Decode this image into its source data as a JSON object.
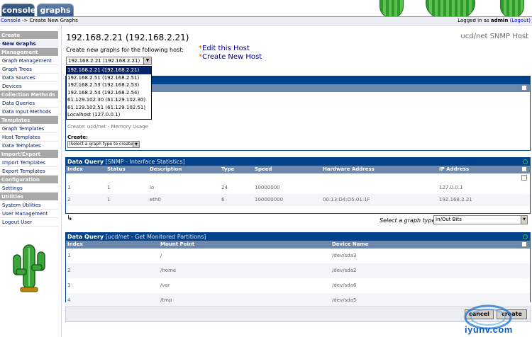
{
  "tabs": [
    {
      "label": "console",
      "active": true
    },
    {
      "label": "graphs",
      "active": false
    }
  ],
  "breadcrumb": {
    "root": "Console",
    "separator": " -> ",
    "current": "Create New Graphs"
  },
  "login": {
    "prefix": "Logged in as ",
    "user": "admin",
    "logout": "(Logout)"
  },
  "sidebar": {
    "sections": [
      {
        "header": "Create",
        "items": [
          {
            "label": "New Graphs",
            "active": true
          }
        ]
      },
      {
        "header": "Management",
        "items": [
          {
            "label": "Graph Management"
          },
          {
            "label": "Graph Trees"
          },
          {
            "label": "Data Sources"
          },
          {
            "label": "Devices"
          }
        ]
      },
      {
        "header": "Collection Methods",
        "items": [
          {
            "label": "Data Queries"
          },
          {
            "label": "Data Input Methods"
          }
        ]
      },
      {
        "header": "Templates",
        "items": [
          {
            "label": "Graph Templates"
          },
          {
            "label": "Host Templates"
          },
          {
            "label": "Data Templates"
          }
        ]
      },
      {
        "header": "Import/Export",
        "items": [
          {
            "label": "Import Templates"
          },
          {
            "label": "Export Templates"
          }
        ]
      },
      {
        "header": "Configuration",
        "items": [
          {
            "label": "Settings"
          }
        ]
      },
      {
        "header": "Utilities",
        "items": [
          {
            "label": "System Utilities"
          },
          {
            "label": "User Management"
          },
          {
            "label": "Logout User"
          }
        ]
      }
    ]
  },
  "host": {
    "title": "192.168.2.21 (192.168.2.21)",
    "template": "ucd/net SNMP Host",
    "prompt": "Create new graphs for the following host:",
    "selected": "192.168.2.21 (192.168.2.21)",
    "options": [
      "192.168.2.21 (192.168.2.21)",
      "192.168.2.51 (192.168.2.51)",
      "192.168.2.53 (192.168.2.53)",
      "192.168.2.54 (192.168.2.54)",
      "61.129.102.30 (61.129.102.30)",
      "61.129.102.51 (61.129.102.51)",
      "Localhost (127.0.0.1)"
    ],
    "edit_link": "Edit this Host",
    "create_link": "Create New Host",
    "star": "*"
  },
  "templates_panel": {
    "partial_row": "Create: ucd/net - Memory Usage",
    "create_label": "Create:",
    "create_select": "(Select a graph type to create)"
  },
  "interface_query": {
    "title": "Data Query",
    "subtitle": "[SNMP - Interface Statistics]",
    "columns": [
      "Index",
      "Status",
      "Description",
      "Type",
      "Speed",
      "Hardware Address",
      "IP Address"
    ],
    "rows": [
      [
        "1",
        "1",
        "lo",
        "24",
        "10000000",
        "",
        "127.0.0.1"
      ],
      [
        "2",
        "1",
        "eth0",
        "6",
        "100000000",
        "00:13:D4:D5:01:1F",
        "192.168.2.21"
      ]
    ],
    "graph_type_label": "Select a graph type:",
    "graph_type": "In/Out Bits",
    "return_arrow": "↳"
  },
  "partitions_query": {
    "title": "Data Query",
    "subtitle": "[ucd/net - Get Monitored Partitions]",
    "columns": [
      "Index",
      "Mount Point",
      "Device Name"
    ],
    "rows": [
      [
        "1",
        "/",
        "/dev/sda3"
      ],
      [
        "2",
        "/home",
        "/dev/sda2"
      ],
      [
        "3",
        "/var",
        "/dev/sda6"
      ],
      [
        "4",
        "/tmp",
        "/dev/sda5"
      ]
    ]
  },
  "buttons": {
    "cancel": "cancel",
    "create": "create"
  },
  "watermark": "iyunv.com",
  "colors": {
    "panel_header": "#00438c",
    "column_header": "#6d88ad",
    "sidebar_header": "#a8a8a8",
    "accent": "#e05a00"
  }
}
